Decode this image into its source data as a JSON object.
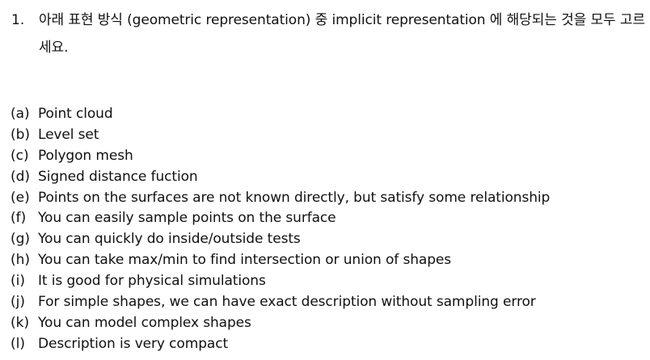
{
  "question": {
    "number": "1.",
    "text": "아래 표현 방식 (geometric representation) 중 implicit representation 에 해당되는 것을 모두 고르세요."
  },
  "options": [
    {
      "label": "(a)",
      "text": "Point cloud"
    },
    {
      "label": "(b)",
      "text": "Level set"
    },
    {
      "label": "(c)",
      "text": "Polygon mesh"
    },
    {
      "label": "(d)",
      "text": "Signed distance fuction"
    },
    {
      "label": "(e)",
      "text": "Points on the surfaces are not known directly, but satisfy some relationship"
    },
    {
      "label": "(f)",
      "text": "You can easily sample points on the surface"
    },
    {
      "label": "(g)",
      "text": "You can quickly do inside/outside tests"
    },
    {
      "label": "(h)",
      "text": "You can take max/min to find intersection or union of shapes"
    },
    {
      "label": "(i)",
      "text": "It is good for physical simulations"
    },
    {
      "label": "(j)",
      "text": "For simple shapes, we can have exact description without sampling error"
    },
    {
      "label": "(k)",
      "text": "You can model complex shapes"
    },
    {
      "label": "(l)",
      "text": "Description is very compact"
    }
  ]
}
